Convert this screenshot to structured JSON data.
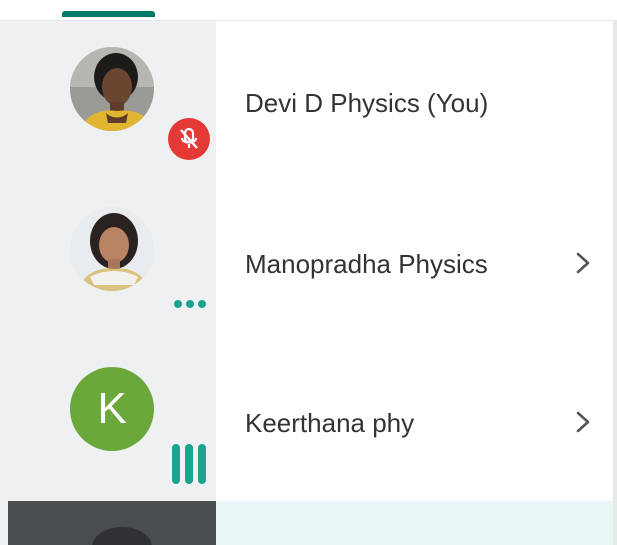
{
  "participants": [
    {
      "name": "Devi D Physics (You)",
      "avatar": "photo-avatar",
      "status_icon": "mic-off-icon",
      "status_color": "#e53935",
      "has_chevron": false
    },
    {
      "name": "Manopradha Physics",
      "avatar": "photo-avatar",
      "status_icon": "more-dots-icon",
      "status_color": "#1aa38f",
      "has_chevron": true
    },
    {
      "name": "Keerthana phy",
      "avatar_letter": "K",
      "avatar_color": "#6aa83c",
      "status_icon": "audio-level-icon",
      "status_color": "#1aa38f",
      "has_chevron": true
    }
  ],
  "colors": {
    "accent": "#00796b",
    "left_panel": "#eef0f2",
    "text": "#333333",
    "highlight_row": "#e8f6f5"
  }
}
